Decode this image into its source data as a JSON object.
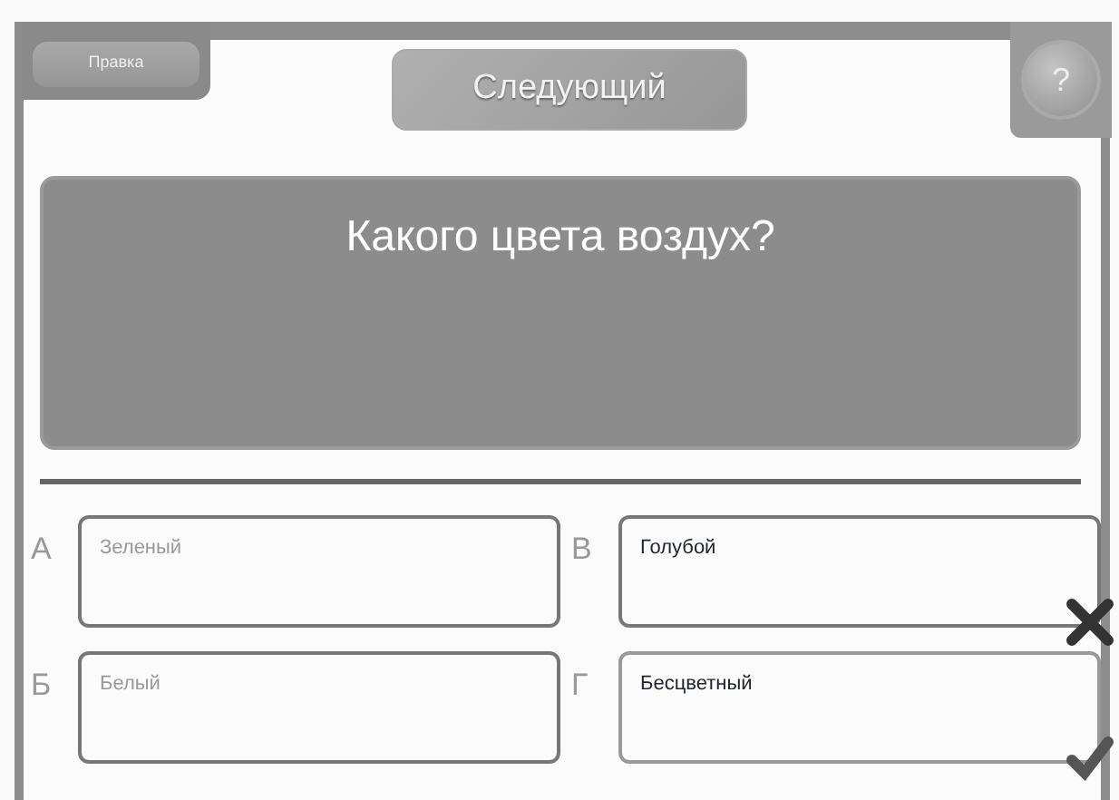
{
  "toolbar": {
    "edit_tab": "Правка",
    "next_button": "Следующий",
    "help_button": "?"
  },
  "question": "Какого цвета воздух?",
  "answers": [
    {
      "letter": "А",
      "text": "Зеленый",
      "dimmed": true,
      "wrong": false,
      "correct": false
    },
    {
      "letter": "В",
      "text": "Голубой",
      "dimmed": false,
      "wrong": true,
      "correct": false
    },
    {
      "letter": "Б",
      "text": "Белый",
      "dimmed": true,
      "wrong": false,
      "correct": false
    },
    {
      "letter": "Г",
      "text": "Бесцветный",
      "dimmed": false,
      "wrong": false,
      "correct": true
    }
  ]
}
